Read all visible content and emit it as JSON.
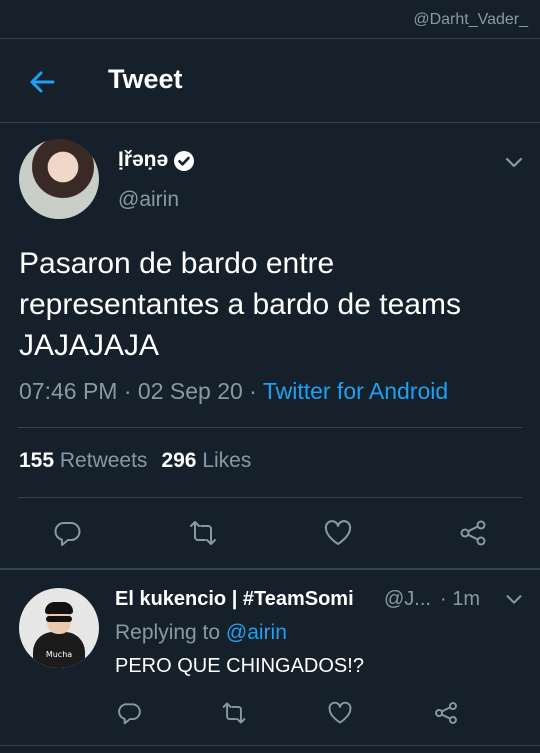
{
  "watermark": "@Darht_Vader_",
  "header": {
    "title": "Tweet",
    "back_icon": "arrow-left-icon"
  },
  "tweet": {
    "display_name": "Ịřəṇə",
    "handle": "@airin",
    "verified_icon": "verified-badge-icon",
    "text": "Pasaron de bardo entre representantes a bardo de teams JAJAJAJA",
    "time": "07:46 PM",
    "separator1": " · ",
    "date": "02 Sep 20",
    "separator2": " · ",
    "source": "Twitter for Android",
    "retweets_count": "155",
    "retweets_label": "Retweets",
    "likes_count": "296",
    "likes_label": "Likes"
  },
  "actions": [
    "reply-icon",
    "retweet-icon",
    "like-icon",
    "share-icon"
  ],
  "reply": {
    "display_name": "El kukencio | #TeamSomi",
    "handle": "@J...",
    "time": "· 1m",
    "replying_label": "Replying to",
    "replying_to": "@airin",
    "text": "PERO QUE CHINGADOS!?",
    "avatar_caption": "Mucha"
  },
  "colors": {
    "background": "#15202b",
    "accent": "#1da1f2",
    "muted": "#8899a6",
    "divider": "#38444d"
  }
}
